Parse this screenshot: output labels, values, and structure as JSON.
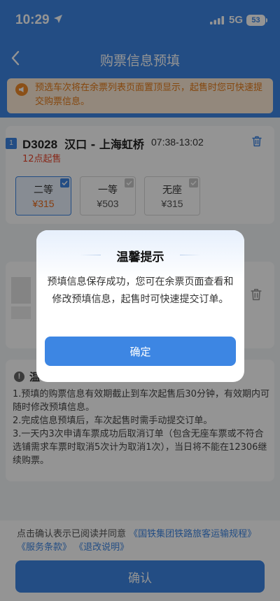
{
  "status_bar": {
    "time": "10:29",
    "network": "5G",
    "battery": "53"
  },
  "nav": {
    "title": "购票信息预填"
  },
  "notice": {
    "text": "预选车次将在余票列表页面置顶显示，起售时您可快速提交购票信息。"
  },
  "train": {
    "index": "1",
    "number": "D3028",
    "route": "汉口 - 上海虹桥",
    "time": "07:38-13:02",
    "sale_time": "12点起售",
    "seats": [
      {
        "name": "二等",
        "price": "¥315",
        "selected": true
      },
      {
        "name": "一等",
        "price": "¥503",
        "selected": false
      },
      {
        "name": "无座",
        "price": "¥315",
        "selected": false
      }
    ]
  },
  "tips": {
    "title": "温",
    "lines": [
      "1.预填的购票信息有效期截止到车次起售后30分钟，有效期内可随时修改预填信息。",
      "2.完成信息预填后，车次起售时需手动提交订单。",
      "3.一天内3次申请车票成功后取消订单（包含无座车票或不符合选铺需求车票时取消5次计为取消1次），当日将不能在12306继续购票。"
    ]
  },
  "bottom": {
    "agree_prefix": "点击确认表示已阅读并同意",
    "links": [
      "《国铁集团铁路旅客运输规程》",
      "《服务条款》",
      "《退改说明》"
    ],
    "confirm_label": "确认"
  },
  "dialog": {
    "title": "温馨提示",
    "message": "预填信息保存成功，您可在余票页面查看和修改预填信息，起售时可快速提交订单。",
    "ok_label": "确定"
  },
  "colors": {
    "primary": "#3d86e3",
    "warning": "#e57a18",
    "price": "#e86a1a",
    "sale": "#e8462c"
  }
}
